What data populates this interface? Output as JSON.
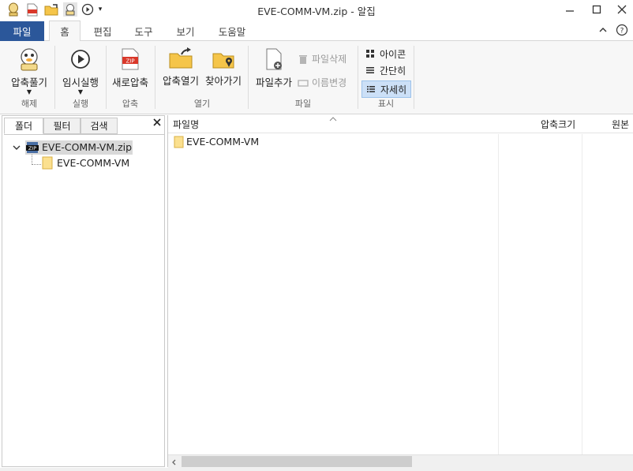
{
  "window": {
    "title": "EVE-COMM-VM.zip - 알집",
    "minimize": "—",
    "maximize": "☐",
    "close": "✕"
  },
  "tabs": {
    "file": "파일",
    "home": "홈",
    "edit": "편집",
    "tools": "도구",
    "view": "보기",
    "help": "도움말"
  },
  "ribbon": {
    "extract": "압축풀기",
    "run": "임시실행",
    "new_zip": "새로압축",
    "open_zip": "압축열기",
    "browse": "찾아가기",
    "add_file": "파일추가",
    "delete_file": "파일삭제",
    "rename": "이름변경",
    "view_icon": "아이콘",
    "view_simple": "간단히",
    "view_detail": "자세히",
    "group_extract": "해제",
    "group_run": "실행",
    "group_compress": "압축",
    "group_open": "열기",
    "group_file": "파일",
    "group_view": "표시"
  },
  "left_panel": {
    "tabs": [
      "폴더",
      "필터",
      "검색"
    ],
    "close": "✕",
    "tree_root": "EVE-COMM-VM.zip",
    "tree_child": "EVE-COMM-VM",
    "zip_badge": "ZIP"
  },
  "list": {
    "columns": {
      "name": "파일명",
      "compressed": "압축크기",
      "original": "원본"
    },
    "rows": [
      {
        "name": "EVE-COMM-VM"
      }
    ]
  },
  "colors": {
    "accent": "#2b579a",
    "folder": "#f5c54a",
    "zip_red": "#d9382a",
    "selected_view": "#cce0f7"
  },
  "icons": [
    "user-mascot-icon",
    "zip-file-icon",
    "folder-open-icon",
    "play-icon",
    "folder-location-icon",
    "add-file-icon",
    "trash-icon",
    "rename-icon",
    "grid-icon",
    "list-icon",
    "detail-list-icon",
    "help-icon",
    "collapse-ribbon-icon"
  ]
}
